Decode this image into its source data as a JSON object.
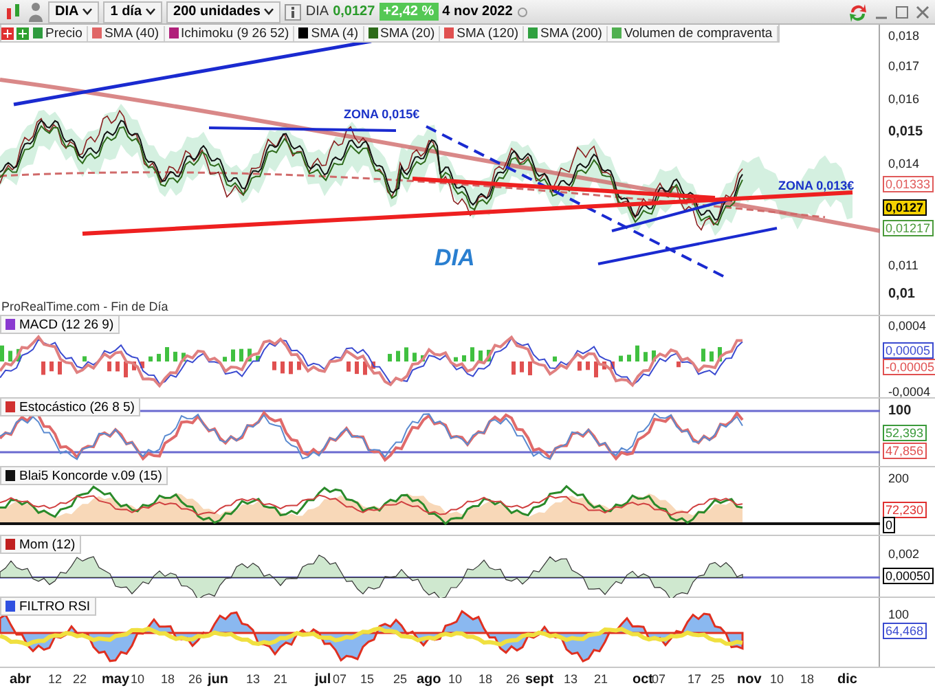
{
  "toolbar": {
    "symbol": "DIA",
    "interval": "1 día",
    "units": "200 unidades",
    "quote": {
      "symbol": "DIA",
      "price": "0,0127",
      "change": "+2,42 %",
      "date": "4 nov 2022"
    }
  },
  "legend": [
    {
      "label": "Precio",
      "color": "#2e9b3e"
    },
    {
      "label": "SMA (40)",
      "color": "#e06666"
    },
    {
      "label": "Ichimoku (9 26 52)",
      "color": "#b0207a"
    },
    {
      "label": "SMA (4)",
      "color": "#000000"
    },
    {
      "label": "SMA (20)",
      "color": "#2d6a1a"
    },
    {
      "label": "SMA (120)",
      "color": "#e05050"
    },
    {
      "label": "SMA (200)",
      "color": "#30a040"
    },
    {
      "label": "Volumen de compraventa",
      "color": "#50b050"
    }
  ],
  "main_chart": {
    "annotations": [
      {
        "kind": "zone",
        "text": "ZONA 0,015€"
      },
      {
        "kind": "zone",
        "text": "ZONA 0,013€"
      },
      {
        "kind": "title",
        "text": "DIA"
      }
    ],
    "source": "ProRealTime.com - Fin de Día",
    "axis_ticks": [
      {
        "label": "0,018",
        "major": false
      },
      {
        "label": "0,017",
        "major": false
      },
      {
        "label": "0,016",
        "major": false
      },
      {
        "label": "0,015",
        "major": true
      },
      {
        "label": "0,014",
        "major": false
      },
      {
        "label": "0,011",
        "major": false
      },
      {
        "label": "0,01",
        "major": true
      }
    ],
    "value_tags": [
      {
        "text": "0,01333",
        "color": "#e05a5a",
        "highlighted": false
      },
      {
        "text": "0,0127",
        "color": "#000000",
        "highlighted": true
      },
      {
        "text": "0,01217",
        "color": "#4a9a3a",
        "highlighted": false
      }
    ]
  },
  "indicators": [
    {
      "kind": "macd",
      "title": "MACD (12 26 9)",
      "color": "#8a3ad0",
      "axis_ticks": [
        {
          "label": "0,0004",
          "major": false
        },
        {
          "label": "-0,0004",
          "major": false
        }
      ],
      "value_tags": [
        {
          "text": "0,00005",
          "color": "#3a4ad0",
          "highlighted": false
        },
        {
          "text": "-0,00005",
          "color": "#e05050",
          "highlighted": false
        }
      ]
    },
    {
      "kind": "stochastic",
      "title": "Estocástico (26 8 5)",
      "color": "#d03030",
      "axis_ticks": [
        {
          "label": "100",
          "major": true
        }
      ],
      "value_tags": [
        {
          "text": "52,393",
          "color": "#3a9a3a",
          "highlighted": false
        },
        {
          "text": "47,856",
          "color": "#e05050",
          "highlighted": false
        }
      ]
    },
    {
      "kind": "koncorde",
      "title": "Blai5 Koncorde v.09 (15)",
      "color": "#111111",
      "axis_ticks": [
        {
          "label": "200",
          "major": false
        }
      ],
      "value_tags": [
        {
          "text": "72,230",
          "color": "#e03030",
          "highlighted": false
        },
        {
          "text": "0",
          "color": "#000000",
          "highlighted": false
        }
      ]
    },
    {
      "kind": "momentum",
      "title": "Mom (12)",
      "color": "#c02020",
      "axis_ticks": [
        {
          "label": "0,002",
          "major": false
        }
      ],
      "value_tags": [
        {
          "text": "0,00050",
          "color": "#000000",
          "highlighted": false
        }
      ]
    },
    {
      "kind": "rsi",
      "title": "FILTRO RSI",
      "color": "#3050e0",
      "axis_ticks": [
        {
          "label": "100",
          "major": false
        }
      ],
      "value_tags": [
        {
          "text": "64,468",
          "color": "#3a4ad0",
          "highlighted": false
        }
      ]
    }
  ],
  "x_axis": [
    {
      "label": "abr",
      "month": true
    },
    {
      "label": "12",
      "month": false
    },
    {
      "label": "22",
      "month": false
    },
    {
      "label": "may",
      "month": true
    },
    {
      "label": "10",
      "month": false
    },
    {
      "label": "18",
      "month": false
    },
    {
      "label": "26",
      "month": false
    },
    {
      "label": "jun",
      "month": true
    },
    {
      "label": "13",
      "month": false
    },
    {
      "label": "21",
      "month": false
    },
    {
      "label": "jul",
      "month": true
    },
    {
      "label": "07",
      "month": false
    },
    {
      "label": "15",
      "month": false
    },
    {
      "label": "25",
      "month": false
    },
    {
      "label": "ago",
      "month": true
    },
    {
      "label": "10",
      "month": false
    },
    {
      "label": "18",
      "month": false
    },
    {
      "label": "26",
      "month": false
    },
    {
      "label": "sept",
      "month": true
    },
    {
      "label": "13",
      "month": false
    },
    {
      "label": "21",
      "month": false
    },
    {
      "label": "oct",
      "month": true
    },
    {
      "label": "07",
      "month": false
    },
    {
      "label": "17",
      "month": false
    },
    {
      "label": "25",
      "month": false
    },
    {
      "label": "nov",
      "month": true
    },
    {
      "label": "10",
      "month": false
    },
    {
      "label": "18",
      "month": false
    },
    {
      "label": "dic",
      "month": true
    }
  ]
}
